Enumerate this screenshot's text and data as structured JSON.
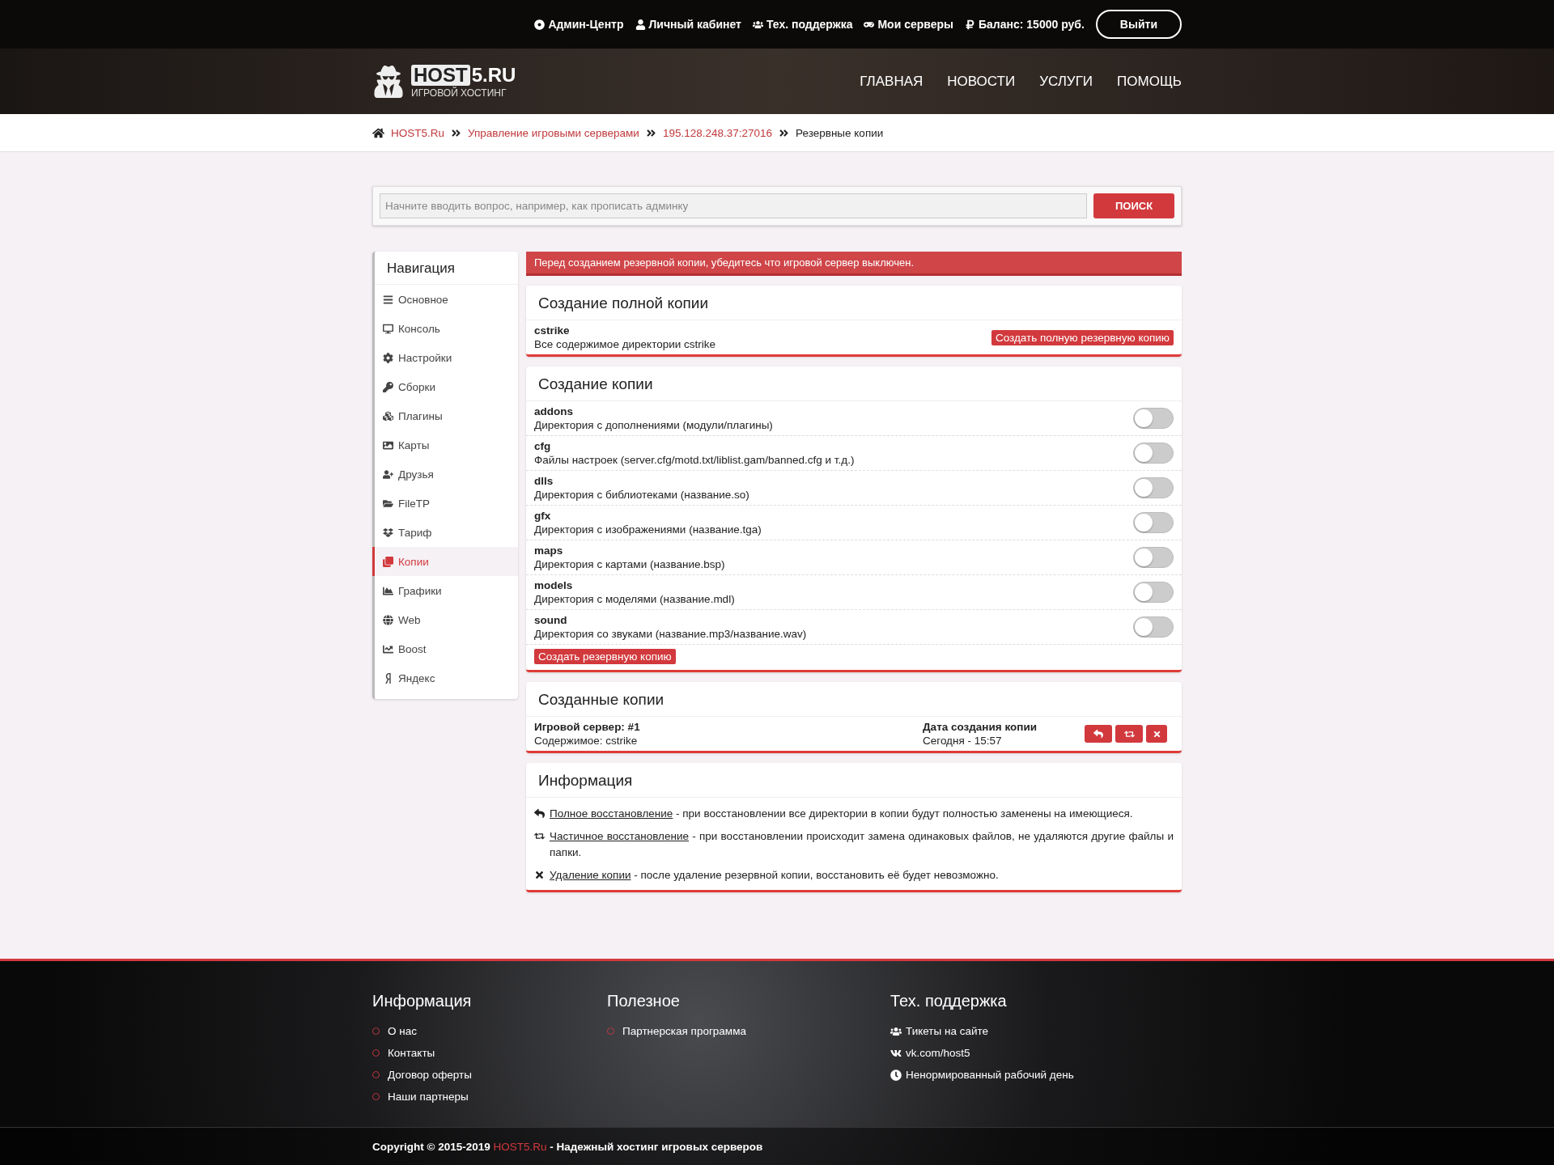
{
  "top_links": [
    {
      "label": "Админ-Центр"
    },
    {
      "label": "Личный кабинет"
    },
    {
      "label": "Тех. поддержка"
    },
    {
      "label": "Мои серверы"
    },
    {
      "label": "Баланс: 15000 руб."
    }
  ],
  "logout": "Выйти",
  "logo": {
    "box": "HOST",
    "rest": "5.RU",
    "tagline": "ИГРОВОЙ ХОСТИНГ"
  },
  "main_nav": [
    "ГЛАВНАЯ",
    "НОВОСТИ",
    "УСЛУГИ",
    "ПОМОЩЬ"
  ],
  "breadcrumb": {
    "links": [
      "HOST5.Ru",
      "Управление игровыми серверами",
      "195.128.248.37:27016"
    ],
    "current": "Резервные копии"
  },
  "search": {
    "placeholder": "Начните вводить вопрос, например, как прописать админку",
    "button": "ПОИСК"
  },
  "sidebar": {
    "title": "Навигация",
    "items": [
      {
        "label": "Основное",
        "selected": false
      },
      {
        "label": "Консоль",
        "selected": false
      },
      {
        "label": "Настройки",
        "selected": false
      },
      {
        "label": "Сборки",
        "selected": false
      },
      {
        "label": "Плагины",
        "selected": false
      },
      {
        "label": "Карты",
        "selected": false
      },
      {
        "label": "Друзья",
        "selected": false
      },
      {
        "label": "FileTP",
        "selected": false
      },
      {
        "label": "Тариф",
        "selected": false
      },
      {
        "label": "Копии",
        "selected": true
      },
      {
        "label": "Графики",
        "selected": false
      },
      {
        "label": "Web",
        "selected": false
      },
      {
        "label": "Boost",
        "selected": false
      },
      {
        "label": "Яндекс",
        "selected": false
      }
    ]
  },
  "alert": "Перед созданием резервной копии, убедитесь что игровой сервер выключен.",
  "full_copy": {
    "title": "Создание полной копии",
    "name": "cstrike",
    "description": "Все содержимое директории cstrike",
    "button": "Создать полную резервную копию"
  },
  "partial_copy": {
    "title": "Создание копии",
    "button": "Создать резервную копию",
    "items": [
      {
        "name": "addons",
        "description": "Директория с дополнениями (модули/плагины)",
        "on": false
      },
      {
        "name": "cfg",
        "description": "Файлы настроек (server.cfg/motd.txt/liblist.gam/banned.cfg и т.д.)",
        "on": false
      },
      {
        "name": "dlls",
        "description": "Директория с библиотеками (название.so)",
        "on": false
      },
      {
        "name": "gfx",
        "description": "Директория с изображениями (название.tga)",
        "on": false
      },
      {
        "name": "maps",
        "description": "Директория с картами (название.bsp)",
        "on": false
      },
      {
        "name": "models",
        "description": "Директория с моделями (название.mdl)",
        "on": false
      },
      {
        "name": "sound",
        "description": "Директория со звуками (название.mp3/название.wav)",
        "on": false
      }
    ]
  },
  "created_copies": {
    "title": "Созданные копии",
    "rows": [
      {
        "server": "Игровой сервер: #1",
        "content": "Содержимое: cstrike",
        "date_label": "Дата создания копии",
        "date": "Сегодня - 15:57"
      }
    ]
  },
  "info": {
    "title": "Информация",
    "lines": [
      {
        "link": "Полное восстановление",
        "text": " - при восстановлении все директории в копии будут полностью заменены на имеющиеся."
      },
      {
        "link": "Частичное восстановление",
        "text": " - при восстановлении происходит замена одинаковых файлов, не удаляются другие файлы и папки."
      },
      {
        "link": "Удаление копии",
        "text": " - после удаление резервной копии, восстановить её будет невозможно."
      }
    ]
  },
  "footer": {
    "columns": [
      {
        "title": "Информация",
        "kind": "bullets",
        "items": [
          "О нас",
          "Контакты",
          "Договор оферты",
          "Наши партнеры"
        ]
      },
      {
        "title": "Полезное",
        "kind": "bullets",
        "items": [
          "Партнерская программа"
        ]
      },
      {
        "title": "Тех. поддержка",
        "kind": "icons",
        "items": [
          "Тикеты на сайте",
          "vk.com/host5",
          "Ненормированный рабочий день"
        ]
      }
    ],
    "copyright": {
      "prefix": "Copyright © 2015-2019 ",
      "link": "HOST5.Ru",
      "suffix": " - Надежный хостинг игровых серверов"
    }
  }
}
